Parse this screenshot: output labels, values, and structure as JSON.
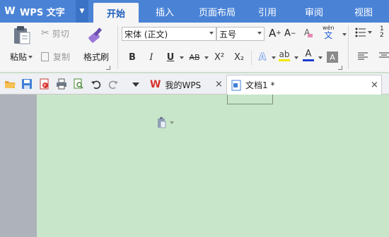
{
  "app": {
    "title": "WPS 文字",
    "logo": "W"
  },
  "menu_tabs": [
    {
      "label": "开始",
      "active": true
    },
    {
      "label": "插入"
    },
    {
      "label": "页面布局"
    },
    {
      "label": "引用"
    },
    {
      "label": "审阅"
    },
    {
      "label": "视图"
    }
  ],
  "ribbon": {
    "clipboard": {
      "paste": "粘贴",
      "cut": "剪切",
      "copy": "复制",
      "format_painter": "格式刷"
    },
    "font": {
      "family": "宋体 (正文)",
      "size": "五号",
      "phonetic_top": "wén",
      "phonetic_bottom": "文"
    },
    "format_glyphs": {
      "bold": "B",
      "italic": "I",
      "underline": "U",
      "strike": "AB",
      "superscript": "X²",
      "subscript": "X₂",
      "text_effect": "A",
      "font_color": "A",
      "shade": "A"
    }
  },
  "doc_tabs": [
    {
      "label": "我的WPS",
      "active": false
    },
    {
      "label": "文档1 *",
      "active": true
    }
  ],
  "colors": {
    "accent": "#4a83d6",
    "page_bg": "#c8e6c9",
    "wps_red": "#d9312d",
    "font_color_bar": "#1e3fd1",
    "highlight_bar": "#f2e600"
  }
}
